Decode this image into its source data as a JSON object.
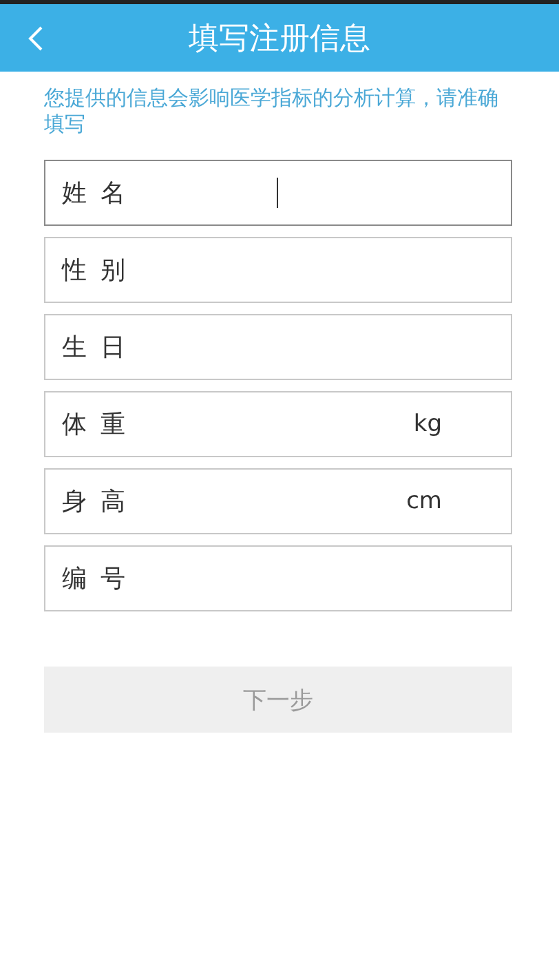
{
  "header": {
    "title": "填写注册信息"
  },
  "notice": "您提供的信息会影响医学指标的分析计算，请准确填写",
  "fields": [
    {
      "label": "姓名",
      "focused": true
    },
    {
      "label": "性别",
      "focused": false
    },
    {
      "label": "生日",
      "focused": false
    },
    {
      "label": "体重",
      "unit": "kg",
      "focused": false
    },
    {
      "label": "身高",
      "unit": "cm",
      "focused": false
    },
    {
      "label": "编号",
      "focused": false
    }
  ],
  "next_button": {
    "label": "下一步",
    "disabled": true
  }
}
